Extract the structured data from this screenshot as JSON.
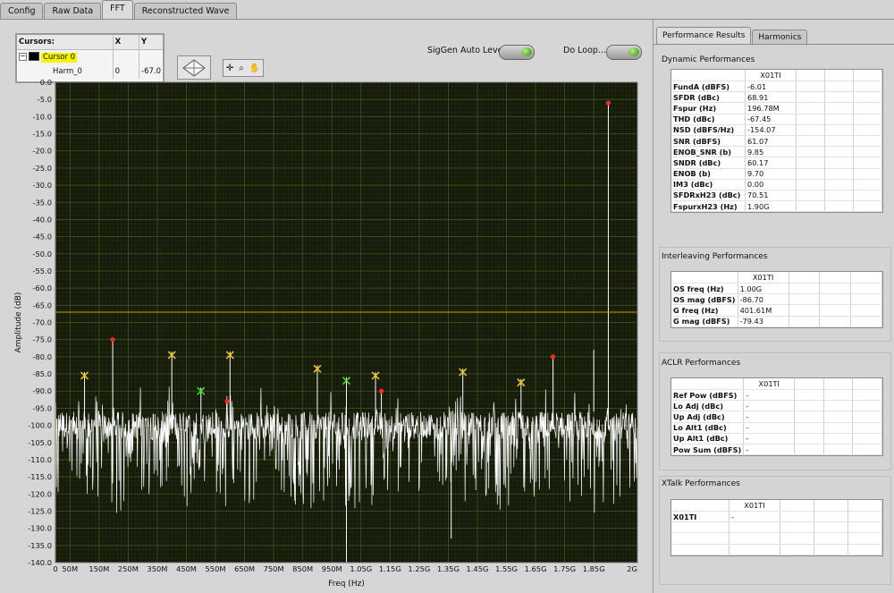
{
  "main_tabs": [
    {
      "label": "Config"
    },
    {
      "label": "Raw Data"
    },
    {
      "label": "FFT"
    },
    {
      "label": "Reconstructed Wave"
    }
  ],
  "cursors": {
    "header": [
      "Cursors:",
      "X",
      "Y"
    ],
    "cursor_name": "Cursor 0",
    "row": {
      "name": "Harm_0",
      "x": "0",
      "y": "-67.0"
    }
  },
  "controls": {
    "sigen_label": "SigGen Auto Level",
    "doloop_label": "Do Loop...",
    "sigen_on": true,
    "doloop_on": true,
    "led_color": "#3aa312"
  },
  "chart_data": {
    "type": "line",
    "xlabel": "Freq (Hz)",
    "ylabel": "Amplitude (dB)",
    "ylim": [
      -140,
      0
    ],
    "xlim": [
      0,
      2000
    ],
    "x_unit": "MHz",
    "y_ticks": [
      "0.0",
      "-5.0",
      "-10.0",
      "-15.0",
      "-20.0",
      "-25.0",
      "-30.0",
      "-35.0",
      "-40.0",
      "-45.0",
      "-50.0",
      "-55.0",
      "-60.0",
      "-65.0",
      "-70.0",
      "-75.0",
      "-80.0",
      "-85.0",
      "-90.0",
      "-95.0",
      "-100.0",
      "-105.0",
      "-110.0",
      "-115.0",
      "-120.0",
      "-125.0",
      "-130.0",
      "-135.0",
      "-140.0"
    ],
    "x_ticks": [
      {
        "label": "0",
        "x": 0
      },
      {
        "label": "50M",
        "x": 50
      },
      {
        "label": "150M",
        "x": 150
      },
      {
        "label": "250M",
        "x": 250
      },
      {
        "label": "350M",
        "x": 350
      },
      {
        "label": "450M",
        "x": 450
      },
      {
        "label": "550M",
        "x": 550
      },
      {
        "label": "650M",
        "x": 650
      },
      {
        "label": "750M",
        "x": 750
      },
      {
        "label": "850M",
        "x": 850
      },
      {
        "label": "950M",
        "x": 950
      },
      {
        "label": "1.05G",
        "x": 1050
      },
      {
        "label": "1.15G",
        "x": 1150
      },
      {
        "label": "1.25G",
        "x": 1250
      },
      {
        "label": "1.35G",
        "x": 1350
      },
      {
        "label": "1.45G",
        "x": 1450
      },
      {
        "label": "1.55G",
        "x": 1550
      },
      {
        "label": "1.65G",
        "x": 1650
      },
      {
        "label": "1.75G",
        "x": 1750
      },
      {
        "label": "1.85G",
        "x": 1850
      },
      {
        "label": "2G",
        "x": 2000
      }
    ],
    "noise_floor": {
      "center": -100,
      "spread": 4
    },
    "cursor_y": -67.0,
    "fundamental": {
      "freq": 1900,
      "level": -6.01,
      "color": "#ff2a2a"
    },
    "spurs_red": [
      {
        "freq": 196.78,
        "level": -75
      },
      {
        "freq": 590,
        "level": -93
      },
      {
        "freq": 1120,
        "level": -90
      },
      {
        "freq": 1710,
        "level": -80
      }
    ],
    "harmonics_yellow": [
      {
        "freq": 100,
        "level": -85.5
      },
      {
        "freq": 400,
        "level": -79.5
      },
      {
        "freq": 600,
        "level": -79.5
      },
      {
        "freq": 900,
        "level": -83.5
      },
      {
        "freq": 1100,
        "level": -85.5
      },
      {
        "freq": 1400,
        "level": -84.5
      },
      {
        "freq": 1600,
        "level": -87.5
      }
    ],
    "harmonics_green": [
      {
        "freq": 500,
        "level": -90
      },
      {
        "freq": 1000,
        "level": -87
      }
    ],
    "tall_spikes": [
      {
        "freq": 1850,
        "level": -78
      },
      {
        "freq": 1000,
        "level": -140
      },
      {
        "freq": 1360,
        "level": -133
      }
    ],
    "colors": {
      "background": "#161a0c",
      "grid": "#3c5a1c",
      "trace": "#ffffff",
      "yellow": "#e8c02a",
      "green": "#4cd62e",
      "red": "#ff2a2a",
      "cursor_line": "#c8a000"
    }
  },
  "right_tabs": [
    {
      "label": "Performance Results"
    },
    {
      "label": "Harmonics"
    }
  ],
  "dynamic": {
    "title": "Dynamic Performances",
    "column": "X01TI",
    "rows": [
      {
        "label": "FundA (dBFS)",
        "value": "-6.01"
      },
      {
        "label": "SFDR (dBc)",
        "value": "68.91"
      },
      {
        "label": "Fspur (Hz)",
        "value": "196.78M"
      },
      {
        "label": "THD (dBc)",
        "value": "-67.45"
      },
      {
        "label": "NSD (dBFS/Hz)",
        "value": "-154.07"
      },
      {
        "label": "SNR (dBFS)",
        "value": "61.07"
      },
      {
        "label": "ENOB_SNR (b)",
        "value": "9.85"
      },
      {
        "label": "SNDR (dBc)",
        "value": "60.17"
      },
      {
        "label": "ENOB (b)",
        "value": "9.70"
      },
      {
        "label": "IM3 (dBc)",
        "value": "0.00"
      },
      {
        "label": "SFDRxH23 (dBc)",
        "value": "70.51"
      },
      {
        "label": "FspurxH23 (Hz)",
        "value": "1.90G"
      }
    ]
  },
  "interleaving": {
    "title": "Interleaving Performances",
    "column": "X01TI",
    "rows": [
      {
        "label": "OS freq (Hz)",
        "value": "1.00G"
      },
      {
        "label": "OS mag (dBFS)",
        "value": "-86.70"
      },
      {
        "label": "G freq (Hz)",
        "value": "401.61M"
      },
      {
        "label": "G mag (dBFS)",
        "value": "-79.43"
      }
    ]
  },
  "aclr": {
    "title": "ACLR Performances",
    "column": "X01TI",
    "rows": [
      {
        "label": "Ref Pow (dBFS)",
        "value": "-"
      },
      {
        "label": "Lo Adj  (dBc)",
        "value": "-"
      },
      {
        "label": "Up Adj  (dBc)",
        "value": "-"
      },
      {
        "label": "Lo Alt1  (dBc)",
        "value": "-"
      },
      {
        "label": "Up Alt1  (dBc)",
        "value": "-"
      },
      {
        "label": "Pow Sum (dBFS)",
        "value": "-"
      }
    ]
  },
  "xtalk": {
    "title": "XTalk Performances",
    "column": "X01TI",
    "row_label": "X01TI",
    "row_value": "-"
  }
}
